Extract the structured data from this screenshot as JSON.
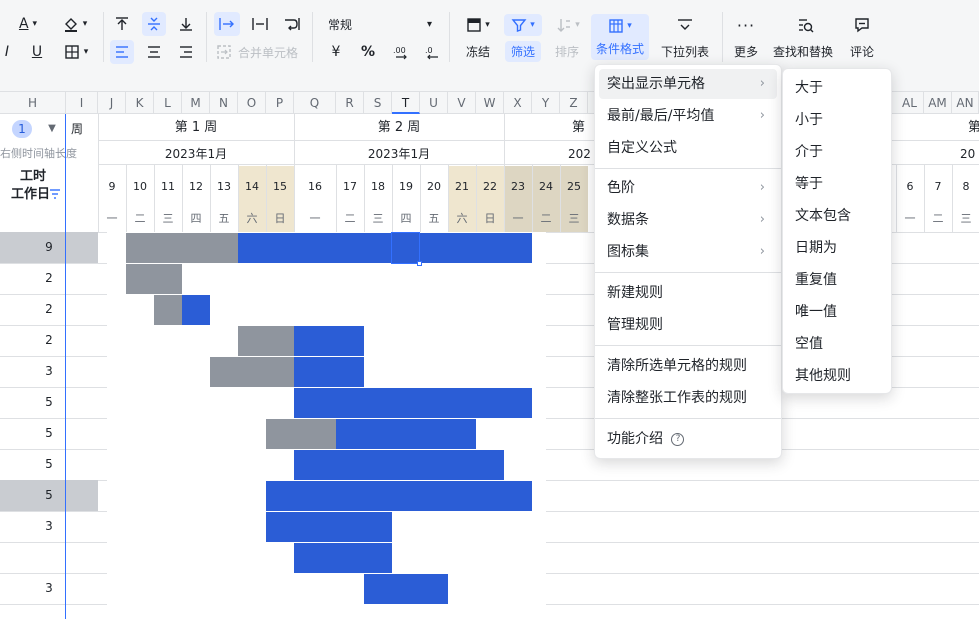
{
  "toolbar": {
    "merge_label": "合并单元格",
    "number_format": "常规",
    "currency_symbol": "¥",
    "percent_symbol": "%",
    "freeze_label": "冻结",
    "filter_label": "筛选",
    "sort_label": "排序",
    "conditional_format_label": "条件格式",
    "dropdown_list_label": "下拉列表",
    "more_label": "更多",
    "find_replace_label": "查找和替换",
    "comment_label": "评论",
    "font_color_letter": "A",
    "left_italic_letter": "I",
    "underline_letter": "U"
  },
  "columns": [
    "H",
    "I",
    "J",
    "K",
    "L",
    "M",
    "N",
    "O",
    "P",
    "Q",
    "R",
    "S",
    "T",
    "U",
    "V",
    "W",
    "X",
    "Y",
    "Z",
    "AL",
    "AM",
    "AN"
  ],
  "grid": {
    "level_badge": "1",
    "week_label": "周",
    "axis_hint": "右侧时间轴长度",
    "workday_header_line1": "工时",
    "workday_header_line2": "工作日",
    "week1": "第 1 周",
    "week2": "第 2 周",
    "week3_partial": "第",
    "week4_partial": "第",
    "month1": "2023年1月",
    "month2": "2023年1月",
    "month3_partial": "202",
    "month4_partial": "20",
    "days_w1": [
      "9",
      "10",
      "11",
      "12",
      "13",
      "14",
      "15"
    ],
    "days_w2": [
      "16",
      "17",
      "18",
      "19",
      "20",
      "21",
      "22"
    ],
    "days_w3": [
      "23",
      "24",
      "25"
    ],
    "days_w4": [
      "6",
      "7",
      "8"
    ],
    "weekdays_w1": [
      "一",
      "二",
      "三",
      "四",
      "五",
      "六",
      "日"
    ],
    "weekdays_w2": [
      "一",
      "二",
      "三",
      "四",
      "五",
      "六",
      "日"
    ],
    "weekdays_w3": [
      "一",
      "二",
      "三"
    ],
    "weekdays_w4": [
      "一",
      "二",
      "三"
    ],
    "workdays": [
      "9",
      "2",
      "2",
      "2",
      "3",
      "5",
      "5",
      "5",
      "5",
      "3",
      "",
      "3"
    ],
    "gantt_rows": [
      {
        "gray_start": 1,
        "gray_days": 4,
        "blue_start": 5,
        "blue_days": 11
      },
      {
        "gray_start": 1,
        "gray_days": 2,
        "blue_start": 0,
        "blue_days": 0
      },
      {
        "gray_start": 2,
        "gray_days": 1,
        "blue_start": 3,
        "blue_days": 1
      },
      {
        "gray_start": 5,
        "gray_days": 2,
        "blue_start": 7,
        "blue_days": 2
      },
      {
        "gray_start": 4,
        "gray_days": 3,
        "blue_start": 7,
        "blue_days": 2
      },
      {
        "gray_start": 0,
        "gray_days": 0,
        "blue_start": 7,
        "blue_days": 8
      },
      {
        "gray_start": 6,
        "gray_days": 2,
        "blue_start": 8,
        "blue_days": 5
      },
      {
        "gray_start": 0,
        "gray_days": 0,
        "blue_start": 7,
        "blue_days": 7
      },
      {
        "gray_start": 0,
        "gray_days": 0,
        "blue_start": 6,
        "blue_days": 9
      },
      {
        "gray_start": 0,
        "gray_days": 0,
        "blue_start": 6,
        "blue_days": 4
      },
      {
        "gray_start": 0,
        "gray_days": 0,
        "blue_start": 7,
        "blue_days": 3
      },
      {
        "gray_start": 0,
        "gray_days": 0,
        "blue_start": 9,
        "blue_days": 3
      }
    ]
  },
  "menu": {
    "items": [
      {
        "label": "突出显示单元格"
      },
      {
        "label": "最前/最后/平均值"
      },
      {
        "label": "自定义公式"
      },
      {
        "label": "色阶"
      },
      {
        "label": "数据条"
      },
      {
        "label": "图标集"
      },
      {
        "label": "新建规则"
      },
      {
        "label": "管理规则"
      },
      {
        "label": "清除所选单元格的规则"
      },
      {
        "label": "清除整张工作表的规则"
      },
      {
        "label": "功能介绍"
      }
    ],
    "chevron": "›",
    "help_glyph": "?"
  },
  "submenu": {
    "items": [
      "大于",
      "小于",
      "介于",
      "等于",
      "文本包含",
      "日期为",
      "重复值",
      "唯一值",
      "空值",
      "其他规则"
    ]
  },
  "colors": {
    "accent": "#3370ff",
    "gantt_blue": "#2b5dd6",
    "gantt_gray": "#8f959e",
    "weekend": "#efe6cf"
  }
}
